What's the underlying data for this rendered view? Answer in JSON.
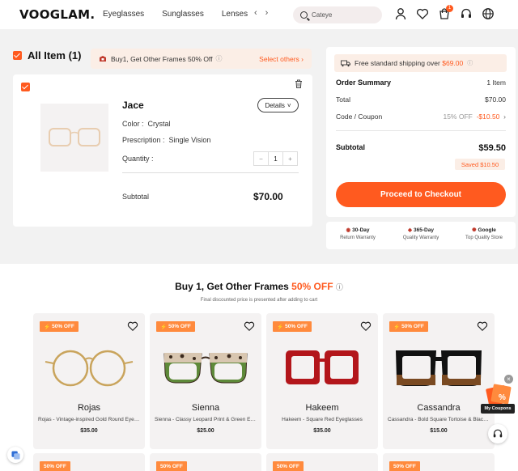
{
  "header": {
    "logo": "VOOGLAM.",
    "nav": [
      "Eyeglasses",
      "Sunglasses",
      "Lenses"
    ],
    "search_value": "Cateye",
    "cart_count": "1",
    "icons": [
      "user-icon",
      "heart-icon",
      "cart-icon",
      "headset-icon",
      "globe-icon"
    ]
  },
  "cart": {
    "all_label": "All Item (1)",
    "promo_text": "Buy1, Get Other Frames 50% Off",
    "promo_link": "Select others",
    "item": {
      "name": "Jace",
      "details_label": "Details",
      "color_label": "Color :",
      "color_value": "Crystal",
      "prescription_label": "Prescription :",
      "prescription_value": "Single Vision",
      "quantity_label": "Quantity :",
      "quantity": "1",
      "subtotal_label": "Subtotal",
      "subtotal_value": "$70.00"
    }
  },
  "summary": {
    "shipping_text": "Free standard shipping over",
    "shipping_amount": "$69.00",
    "title": "Order Summary",
    "item_count": "1 Item",
    "total_label": "Total",
    "total_value": "$70.00",
    "coupon_label": "Code / Coupon",
    "coupon_off": "15% OFF",
    "coupon_value": "-$10.50",
    "subtotal_label": "Subtotal",
    "subtotal_value": "$59.50",
    "saved": "Saved $10.50",
    "checkout": "Proceed to Checkout"
  },
  "guarantees": [
    {
      "title": "30-Day",
      "sub": "Return Warranty"
    },
    {
      "title": "365-Day",
      "sub": "Quality Warranty"
    },
    {
      "title": "Google",
      "sub": "Top Quality Store"
    }
  ],
  "upsell": {
    "title_start": "Buy 1, Get Other Frames",
    "title_highlight": "50% OFF",
    "subtitle": "Final discounted price is presented after adding to cart",
    "badge": "50% OFF",
    "products": [
      {
        "name": "Rojas",
        "desc": "Rojas - Vintage-inspired Gold Round Eyeglasses",
        "price": "$35.00"
      },
      {
        "name": "Sienna",
        "desc": "Sienna - Classy Leopard Print & Green Eyeglasses",
        "price": "$25.00"
      },
      {
        "name": "Hakeem",
        "desc": "Hakeem - Square Red Eyeglasses",
        "price": "$35.00"
      },
      {
        "name": "Cassandra",
        "desc": "Cassandra - Bold Square Tortoise & Black Eyeglasses",
        "price": "$15.00"
      }
    ]
  },
  "floating": {
    "coupon_label": "My Coupons"
  },
  "colors": {
    "accent": "#ff5a1f",
    "promo_bg": "#fbeee6"
  }
}
